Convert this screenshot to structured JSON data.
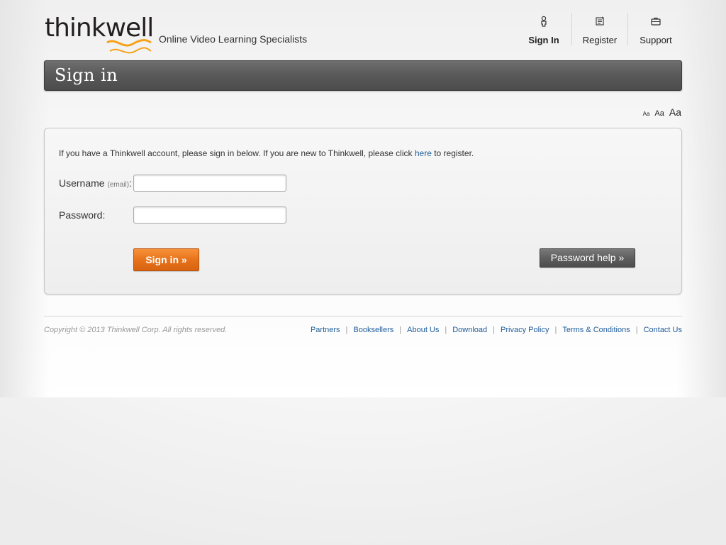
{
  "brand": {
    "logo_text": "thinkwell",
    "tagline": "Online Video Learning Specialists",
    "accent_color": "#f7a21b"
  },
  "topnav": {
    "items": [
      {
        "label": "Sign In",
        "icon": "person-icon",
        "active": true
      },
      {
        "label": "Register",
        "icon": "register-icon",
        "active": false
      },
      {
        "label": "Support",
        "icon": "briefcase-icon",
        "active": false
      }
    ]
  },
  "page": {
    "title": "Sign in"
  },
  "font_size": {
    "small": "Aa",
    "medium": "Aa",
    "large": "Aa"
  },
  "form": {
    "intro_before": "If you have a Thinkwell account, please sign in below. If you are new to Thinkwell, please click ",
    "intro_link": "here",
    "intro_after": " to register.",
    "username_label": "Username",
    "username_hint": "(email)",
    "username_colon": ":",
    "username_value": "",
    "password_label": "Password:",
    "password_value": "",
    "signin_button": "Sign in »",
    "password_help_button": "Password help »",
    "signin_color": "#e8731b",
    "help_color": "#5f5f5f"
  },
  "footer": {
    "copyright": "Copyright © 2013 Thinkwell Corp. All rights reserved.",
    "links": [
      "Partners",
      "Booksellers",
      "About Us",
      "Download",
      "Privacy Policy",
      "Terms & Conditions",
      "Contact Us"
    ],
    "separator": "|"
  }
}
